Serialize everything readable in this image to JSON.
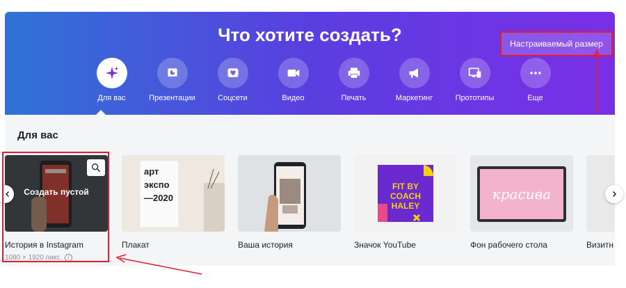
{
  "header": {
    "title": "Что хотите создать?",
    "custom_size_button": "Настраиваемый размер"
  },
  "categories": [
    {
      "label": "Для вас",
      "icon": "sparkle-icon",
      "active": true
    },
    {
      "label": "Презентации",
      "icon": "presentation-icon"
    },
    {
      "label": "Соцсети",
      "icon": "heart-icon"
    },
    {
      "label": "Видео",
      "icon": "video-icon"
    },
    {
      "label": "Печать",
      "icon": "printer-icon"
    },
    {
      "label": "Маркетинг",
      "icon": "megaphone-icon"
    },
    {
      "label": "Прототипы",
      "icon": "devices-icon"
    },
    {
      "label": "Еще",
      "icon": "more-icon"
    }
  ],
  "section": {
    "title": "Для вас"
  },
  "cards": [
    {
      "label": "История в Instagram",
      "overlay": "Создать пустой",
      "sub": "1080 × 1920 пикс."
    },
    {
      "label": "Плакат",
      "poster_lines": [
        "арт",
        "экспо",
        "—2020"
      ]
    },
    {
      "label": "Ваша история"
    },
    {
      "label": "Значок YouTube",
      "badge_lines": [
        "FIT BY",
        "COACH",
        "HALEY"
      ]
    },
    {
      "label": "Фон рабочего стола",
      "screen_text": "красива"
    },
    {
      "label": "Визитн"
    }
  ],
  "colors": {
    "gradient_start": "#2f73d6",
    "gradient_end": "#7a2fe6",
    "highlight_red": "#e41b2f"
  }
}
